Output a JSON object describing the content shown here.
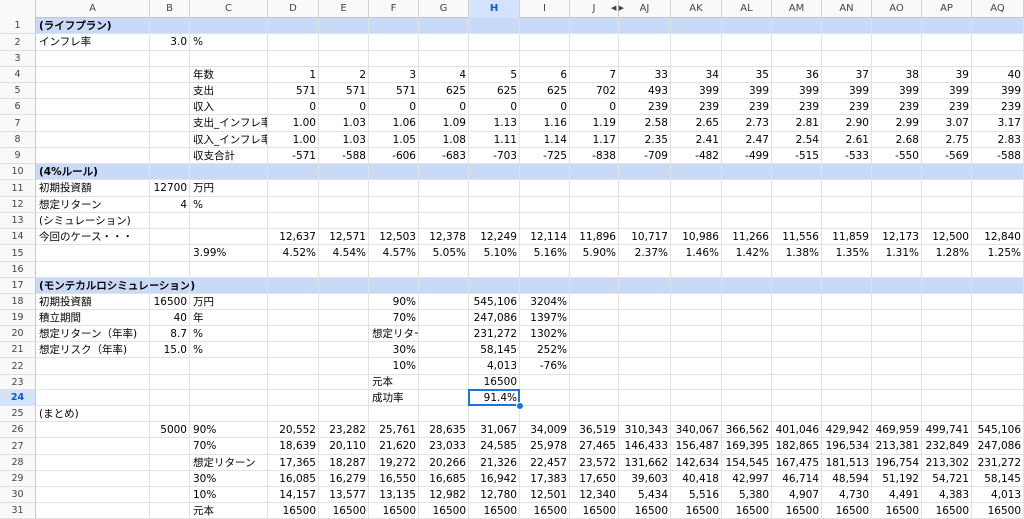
{
  "columns": [
    "A",
    "B",
    "C",
    "D",
    "E",
    "F",
    "G",
    "H",
    "I",
    "J",
    "AJ",
    "AK",
    "AL",
    "AM",
    "AN",
    "AO",
    "AP",
    "AQ"
  ],
  "selected_column": "H",
  "selected_row": 24,
  "selected_cell": "H24",
  "section_rows": [
    1,
    10,
    17
  ],
  "rows": [
    {
      "n": 1,
      "cells": {
        "A": "(ライフプラン)"
      }
    },
    {
      "n": 2,
      "cells": {
        "A": "インフレ率",
        "B": "3.0",
        "C": "%"
      }
    },
    {
      "n": 3,
      "cells": {}
    },
    {
      "n": 4,
      "cells": {
        "C": "年数",
        "D": "1",
        "E": "2",
        "F": "3",
        "G": "4",
        "H": "5",
        "I": "6",
        "J": "7",
        "AJ": "33",
        "AK": "34",
        "AL": "35",
        "AM": "36",
        "AN": "37",
        "AO": "38",
        "AP": "39",
        "AQ": "40"
      }
    },
    {
      "n": 5,
      "cells": {
        "C": "支出",
        "D": "571",
        "E": "571",
        "F": "571",
        "G": "625",
        "H": "625",
        "I": "625",
        "J": "702",
        "AJ": "493",
        "AK": "399",
        "AL": "399",
        "AM": "399",
        "AN": "399",
        "AO": "399",
        "AP": "399",
        "AQ": "399"
      }
    },
    {
      "n": 6,
      "cells": {
        "C": "収入",
        "D": "0",
        "E": "0",
        "F": "0",
        "G": "0",
        "H": "0",
        "I": "0",
        "J": "0",
        "AJ": "239",
        "AK": "239",
        "AL": "239",
        "AM": "239",
        "AN": "239",
        "AO": "239",
        "AP": "239",
        "AQ": "239"
      }
    },
    {
      "n": 7,
      "cells": {
        "C": "支出_インフレ率",
        "D": "1.00",
        "E": "1.03",
        "F": "1.06",
        "G": "1.09",
        "H": "1.13",
        "I": "1.16",
        "J": "1.19",
        "AJ": "2.58",
        "AK": "2.65",
        "AL": "2.73",
        "AM": "2.81",
        "AN": "2.90",
        "AO": "2.99",
        "AP": "3.07",
        "AQ": "3.17"
      }
    },
    {
      "n": 8,
      "cells": {
        "C": "収入_インフレ率",
        "D": "1.00",
        "E": "1.03",
        "F": "1.05",
        "G": "1.08",
        "H": "1.11",
        "I": "1.14",
        "J": "1.17",
        "AJ": "2.35",
        "AK": "2.41",
        "AL": "2.47",
        "AM": "2.54",
        "AN": "2.61",
        "AO": "2.68",
        "AP": "2.75",
        "AQ": "2.83"
      }
    },
    {
      "n": 9,
      "cells": {
        "C": "収支合計",
        "D": "-571",
        "E": "-588",
        "F": "-606",
        "G": "-683",
        "H": "-703",
        "I": "-725",
        "J": "-838",
        "AJ": "-709",
        "AK": "-482",
        "AL": "-499",
        "AM": "-515",
        "AN": "-533",
        "AO": "-550",
        "AP": "-569",
        "AQ": "-588"
      }
    },
    {
      "n": 10,
      "cells": {
        "A": "(4%ルール)"
      }
    },
    {
      "n": 11,
      "cells": {
        "A": "初期投資額",
        "B": "12700",
        "C": "万円"
      }
    },
    {
      "n": 12,
      "cells": {
        "A": "想定リターン",
        "B": "4",
        "C": "%"
      }
    },
    {
      "n": 13,
      "cells": {
        "A": "(シミュレーション)"
      }
    },
    {
      "n": 14,
      "cells": {
        "A": "今回のケース・・・",
        "D": "12,637",
        "E": "12,571",
        "F": "12,503",
        "G": "12,378",
        "H": "12,249",
        "I": "12,114",
        "J": "11,896",
        "AJ": "10,717",
        "AK": "10,986",
        "AL": "11,266",
        "AM": "11,556",
        "AN": "11,859",
        "AO": "12,173",
        "AP": "12,500",
        "AQ": "12,840"
      }
    },
    {
      "n": 15,
      "cells": {
        "C": "3.99%",
        "D": "4.52%",
        "E": "4.54%",
        "F": "4.57%",
        "G": "5.05%",
        "H": "5.10%",
        "I": "5.16%",
        "J": "5.90%",
        "AJ": "2.37%",
        "AK": "1.46%",
        "AL": "1.42%",
        "AM": "1.38%",
        "AN": "1.35%",
        "AO": "1.31%",
        "AP": "1.28%",
        "AQ": "1.25%"
      }
    },
    {
      "n": 16,
      "cells": {}
    },
    {
      "n": 17,
      "cells": {
        "A": "(モンテカルロシミュレーション)"
      }
    },
    {
      "n": 18,
      "cells": {
        "A": "初期投資額",
        "B": "16500",
        "C": "万円",
        "F": "90%",
        "H": "545,106",
        "I": "3204%"
      }
    },
    {
      "n": 19,
      "cells": {
        "A": "積立期間",
        "B": "40",
        "C": "年",
        "F": "70%",
        "H": "247,086",
        "I": "1397%"
      }
    },
    {
      "n": 20,
      "cells": {
        "A": "想定リターン（年率)",
        "B": "8.7",
        "C": "%",
        "F": "想定リターン",
        "H": "231,272",
        "I": "1302%"
      }
    },
    {
      "n": 21,
      "cells": {
        "A": "想定リスク（年率)",
        "B": "15.0",
        "C": "%",
        "F": "30%",
        "H": "58,145",
        "I": "252%"
      }
    },
    {
      "n": 22,
      "cells": {
        "F": "10%",
        "H": "4,013",
        "I": "-76%"
      }
    },
    {
      "n": 23,
      "cells": {
        "F": "元本",
        "H": "16500"
      }
    },
    {
      "n": 24,
      "cells": {
        "F": "成功率",
        "H": "91.4%"
      }
    },
    {
      "n": 25,
      "cells": {
        "A": "(まとめ)"
      }
    },
    {
      "n": 26,
      "cells": {
        "B": "5000",
        "C": "90%",
        "D": "20,552",
        "E": "23,282",
        "F": "25,761",
        "G": "28,635",
        "H": "31,067",
        "I": "34,009",
        "J": "36,519",
        "AJ": "310,343",
        "AK": "340,067",
        "AL": "366,562",
        "AM": "401,046",
        "AN": "429,942",
        "AO": "469,959",
        "AP": "499,741",
        "AQ": "545,106"
      }
    },
    {
      "n": 27,
      "cells": {
        "C": "70%",
        "D": "18,639",
        "E": "20,110",
        "F": "21,620",
        "G": "23,033",
        "H": "24,585",
        "I": "25,978",
        "J": "27,465",
        "AJ": "146,433",
        "AK": "156,487",
        "AL": "169,395",
        "AM": "182,865",
        "AN": "196,534",
        "AO": "213,381",
        "AP": "232,849",
        "AQ": "247,086"
      }
    },
    {
      "n": 28,
      "cells": {
        "C": "想定リターン",
        "D": "17,365",
        "E": "18,287",
        "F": "19,272",
        "G": "20,266",
        "H": "21,326",
        "I": "22,457",
        "J": "23,572",
        "AJ": "131,662",
        "AK": "142,634",
        "AL": "154,545",
        "AM": "167,475",
        "AN": "181,513",
        "AO": "196,754",
        "AP": "213,302",
        "AQ": "231,272"
      }
    },
    {
      "n": 29,
      "cells": {
        "C": "30%",
        "D": "16,085",
        "E": "16,279",
        "F": "16,550",
        "G": "16,685",
        "H": "16,942",
        "I": "17,383",
        "J": "17,650",
        "AJ": "39,603",
        "AK": "40,418",
        "AL": "42,997",
        "AM": "46,714",
        "AN": "48,594",
        "AO": "51,192",
        "AP": "54,721",
        "AQ": "58,145"
      }
    },
    {
      "n": 30,
      "cells": {
        "C": "10%",
        "D": "14,157",
        "E": "13,577",
        "F": "13,135",
        "G": "12,982",
        "H": "12,780",
        "I": "12,501",
        "J": "12,340",
        "AJ": "5,434",
        "AK": "5,516",
        "AL": "5,380",
        "AM": "4,907",
        "AN": "4,730",
        "AO": "4,491",
        "AP": "4,383",
        "AQ": "4,013"
      }
    },
    {
      "n": 31,
      "cells": {
        "C": "元本",
        "D": "16500",
        "E": "16500",
        "F": "16500",
        "G": "16500",
        "H": "16500",
        "I": "16500",
        "J": "16500",
        "AJ": "16500",
        "AK": "16500",
        "AL": "16500",
        "AM": "16500",
        "AN": "16500",
        "AO": "16500",
        "AP": "16500",
        "AQ": "16500"
      }
    }
  ],
  "colors": {
    "section_band": "#c9daf8",
    "selection": "#1a73e8",
    "header_bg": "#f8f9fa"
  }
}
